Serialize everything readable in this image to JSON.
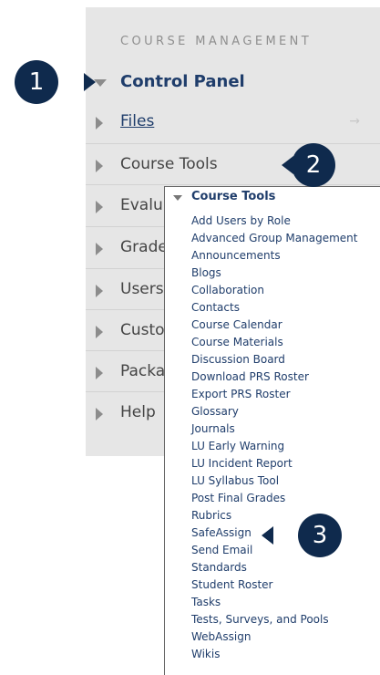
{
  "panel": {
    "header": "COURSE MANAGEMENT",
    "items": [
      {
        "label": "Control Panel"
      },
      {
        "label": "Files"
      },
      {
        "label": "Course Tools"
      },
      {
        "label": "Evalu"
      },
      {
        "label": "Grade"
      },
      {
        "label": "Users"
      },
      {
        "label": "Custo"
      },
      {
        "label": "Packa"
      },
      {
        "label": "Help"
      }
    ]
  },
  "dropdown": {
    "title": "Course Tools",
    "items": [
      "Add Users by Role",
      "Advanced Group Management",
      "Announcements",
      "Blogs",
      "Collaboration",
      "Contacts",
      "Course Calendar",
      "Course Materials",
      "Discussion Board",
      "Download PRS Roster",
      "Export PRS Roster",
      "Glossary",
      "Journals",
      "LU Early Warning",
      "LU Incident Report",
      "LU Syllabus Tool",
      "Post Final Grades",
      "Rubrics",
      "SafeAssign",
      "Send Email",
      "Standards",
      "Student Roster",
      "Tasks",
      "Tests, Surveys, and Pools",
      "WebAssign",
      "Wikis"
    ]
  },
  "callouts": [
    "1",
    "2",
    "3"
  ],
  "colors": {
    "callout": "#0f2a4d",
    "panel_bg": "#e6e6e6",
    "link": "#1f3d6b"
  }
}
